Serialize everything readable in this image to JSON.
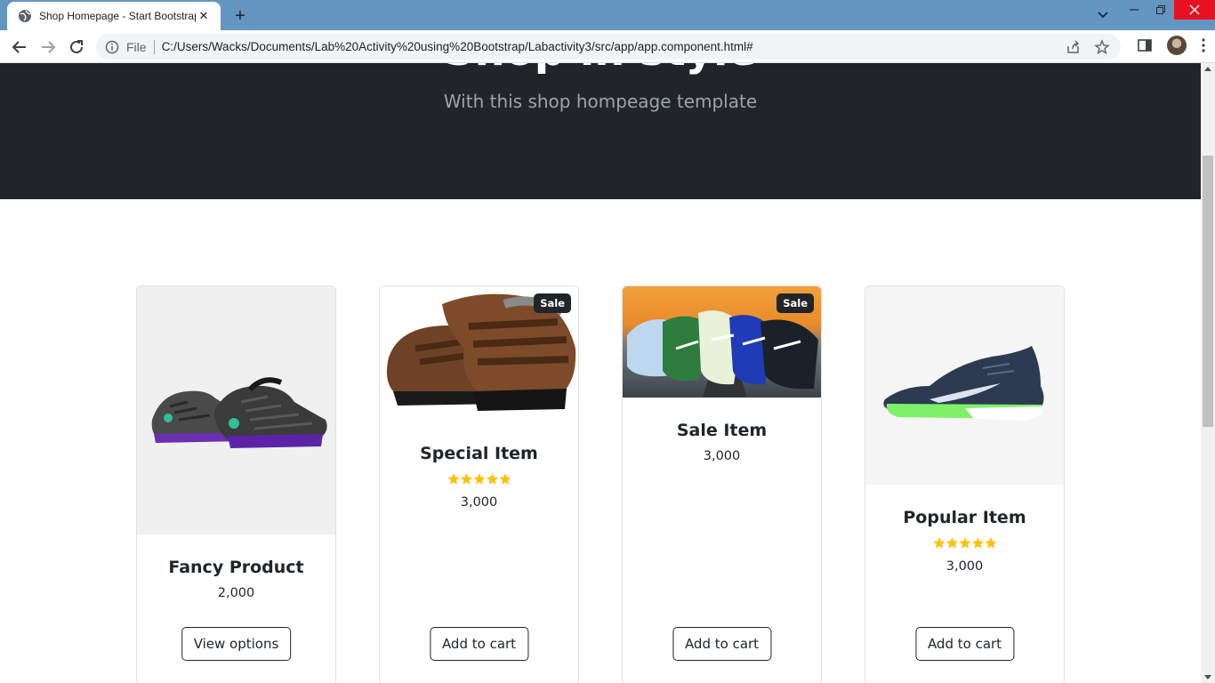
{
  "browser": {
    "tab_title": "Shop Homepage - Start Bootstrap",
    "tab_close": "✕",
    "new_tab": "+",
    "url_scheme_label": "File",
    "url": "C:/Users/Wacks/Documents/Lab%20Activity%20using%20Bootstrap/Labactivity3/src/app/app.component.html#"
  },
  "hero": {
    "title": "Shop in style",
    "subtitle": "With this shop hompeage template"
  },
  "products": [
    {
      "name": "Fancy Product",
      "price": "2,000",
      "rating": 0,
      "button": "View options",
      "badge": ""
    },
    {
      "name": "Special Item",
      "price": "3,000",
      "rating": 5,
      "button": "Add to cart",
      "badge": "Sale"
    },
    {
      "name": "Sale Item",
      "price": "3,000",
      "rating": 0,
      "button": "Add to cart",
      "badge": "Sale"
    },
    {
      "name": "Popular Item",
      "price": "3,000",
      "rating": 5,
      "button": "Add to cart",
      "badge": ""
    }
  ],
  "colors": {
    "tabbar": "#6496c2",
    "hero_bg": "#212529",
    "star": "#ffc107",
    "close_button": "#e81123"
  }
}
